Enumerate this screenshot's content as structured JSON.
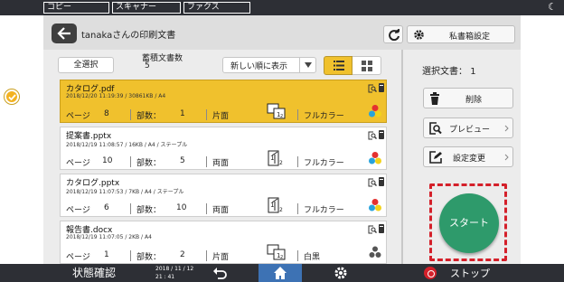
{
  "app_tabs": [
    "コピー",
    "スキャナー",
    "ファクス"
  ],
  "header": {
    "title": "tanakaさんの印刷文書",
    "mailbox_settings_label": "私書箱設定"
  },
  "toolbar": {
    "select_all_label": "全選択",
    "stored_docs_label": "蓄積文書数",
    "stored_docs_count": "5",
    "sort_label": "新しい順に表示"
  },
  "documents": [
    {
      "name": "カタログ.pdf",
      "meta": "2018/12/20 11:19:39 / 30861KB / A4",
      "pages_label": "ページ",
      "pages": "8",
      "copies_label": "部数：",
      "copies": "1",
      "sides": "片面",
      "color": "フルカラー",
      "selected": true
    },
    {
      "name": "提案書.pptx",
      "meta": "2018/12/19 11:08:57 / 16KB / A4 / ステープル",
      "pages_label": "ページ",
      "pages": "10",
      "copies_label": "部数：",
      "copies": "5",
      "sides": "両面",
      "color": "フルカラー",
      "selected": false
    },
    {
      "name": "カタログ.pptx",
      "meta": "2018/12/19 11:07:53 / 7KB / A4 / ステープル",
      "pages_label": "ページ",
      "pages": "6",
      "copies_label": "部数：",
      "copies": "10",
      "sides": "両面",
      "color": "フルカラー",
      "selected": false
    },
    {
      "name": "報告書.docx",
      "meta": "2018/12/19 11:07:05 / 2KB / A4",
      "pages_label": "ページ",
      "pages": "1",
      "copies_label": "部数：",
      "copies": "2",
      "sides": "片面",
      "color": "白黒",
      "selected": false
    }
  ],
  "side_panel": {
    "selected_docs_label": "選択文書：",
    "selected_docs_count": "1",
    "delete_label": "削除",
    "preview_label": "プレビュー",
    "change_settings_label": "設定変更",
    "start_label": "スタート"
  },
  "bottom_bar": {
    "status_label": "状態確認",
    "date": "2018 / 11 / 12",
    "time": "21 : 41",
    "stop_label": "ストップ"
  },
  "colors": {
    "accent_yellow": "#f0c12d",
    "start_green": "#2e9a6b",
    "stop_red": "#d4202a",
    "home_blue": "#3d72b4",
    "dark_bar": "#2d2f35"
  }
}
